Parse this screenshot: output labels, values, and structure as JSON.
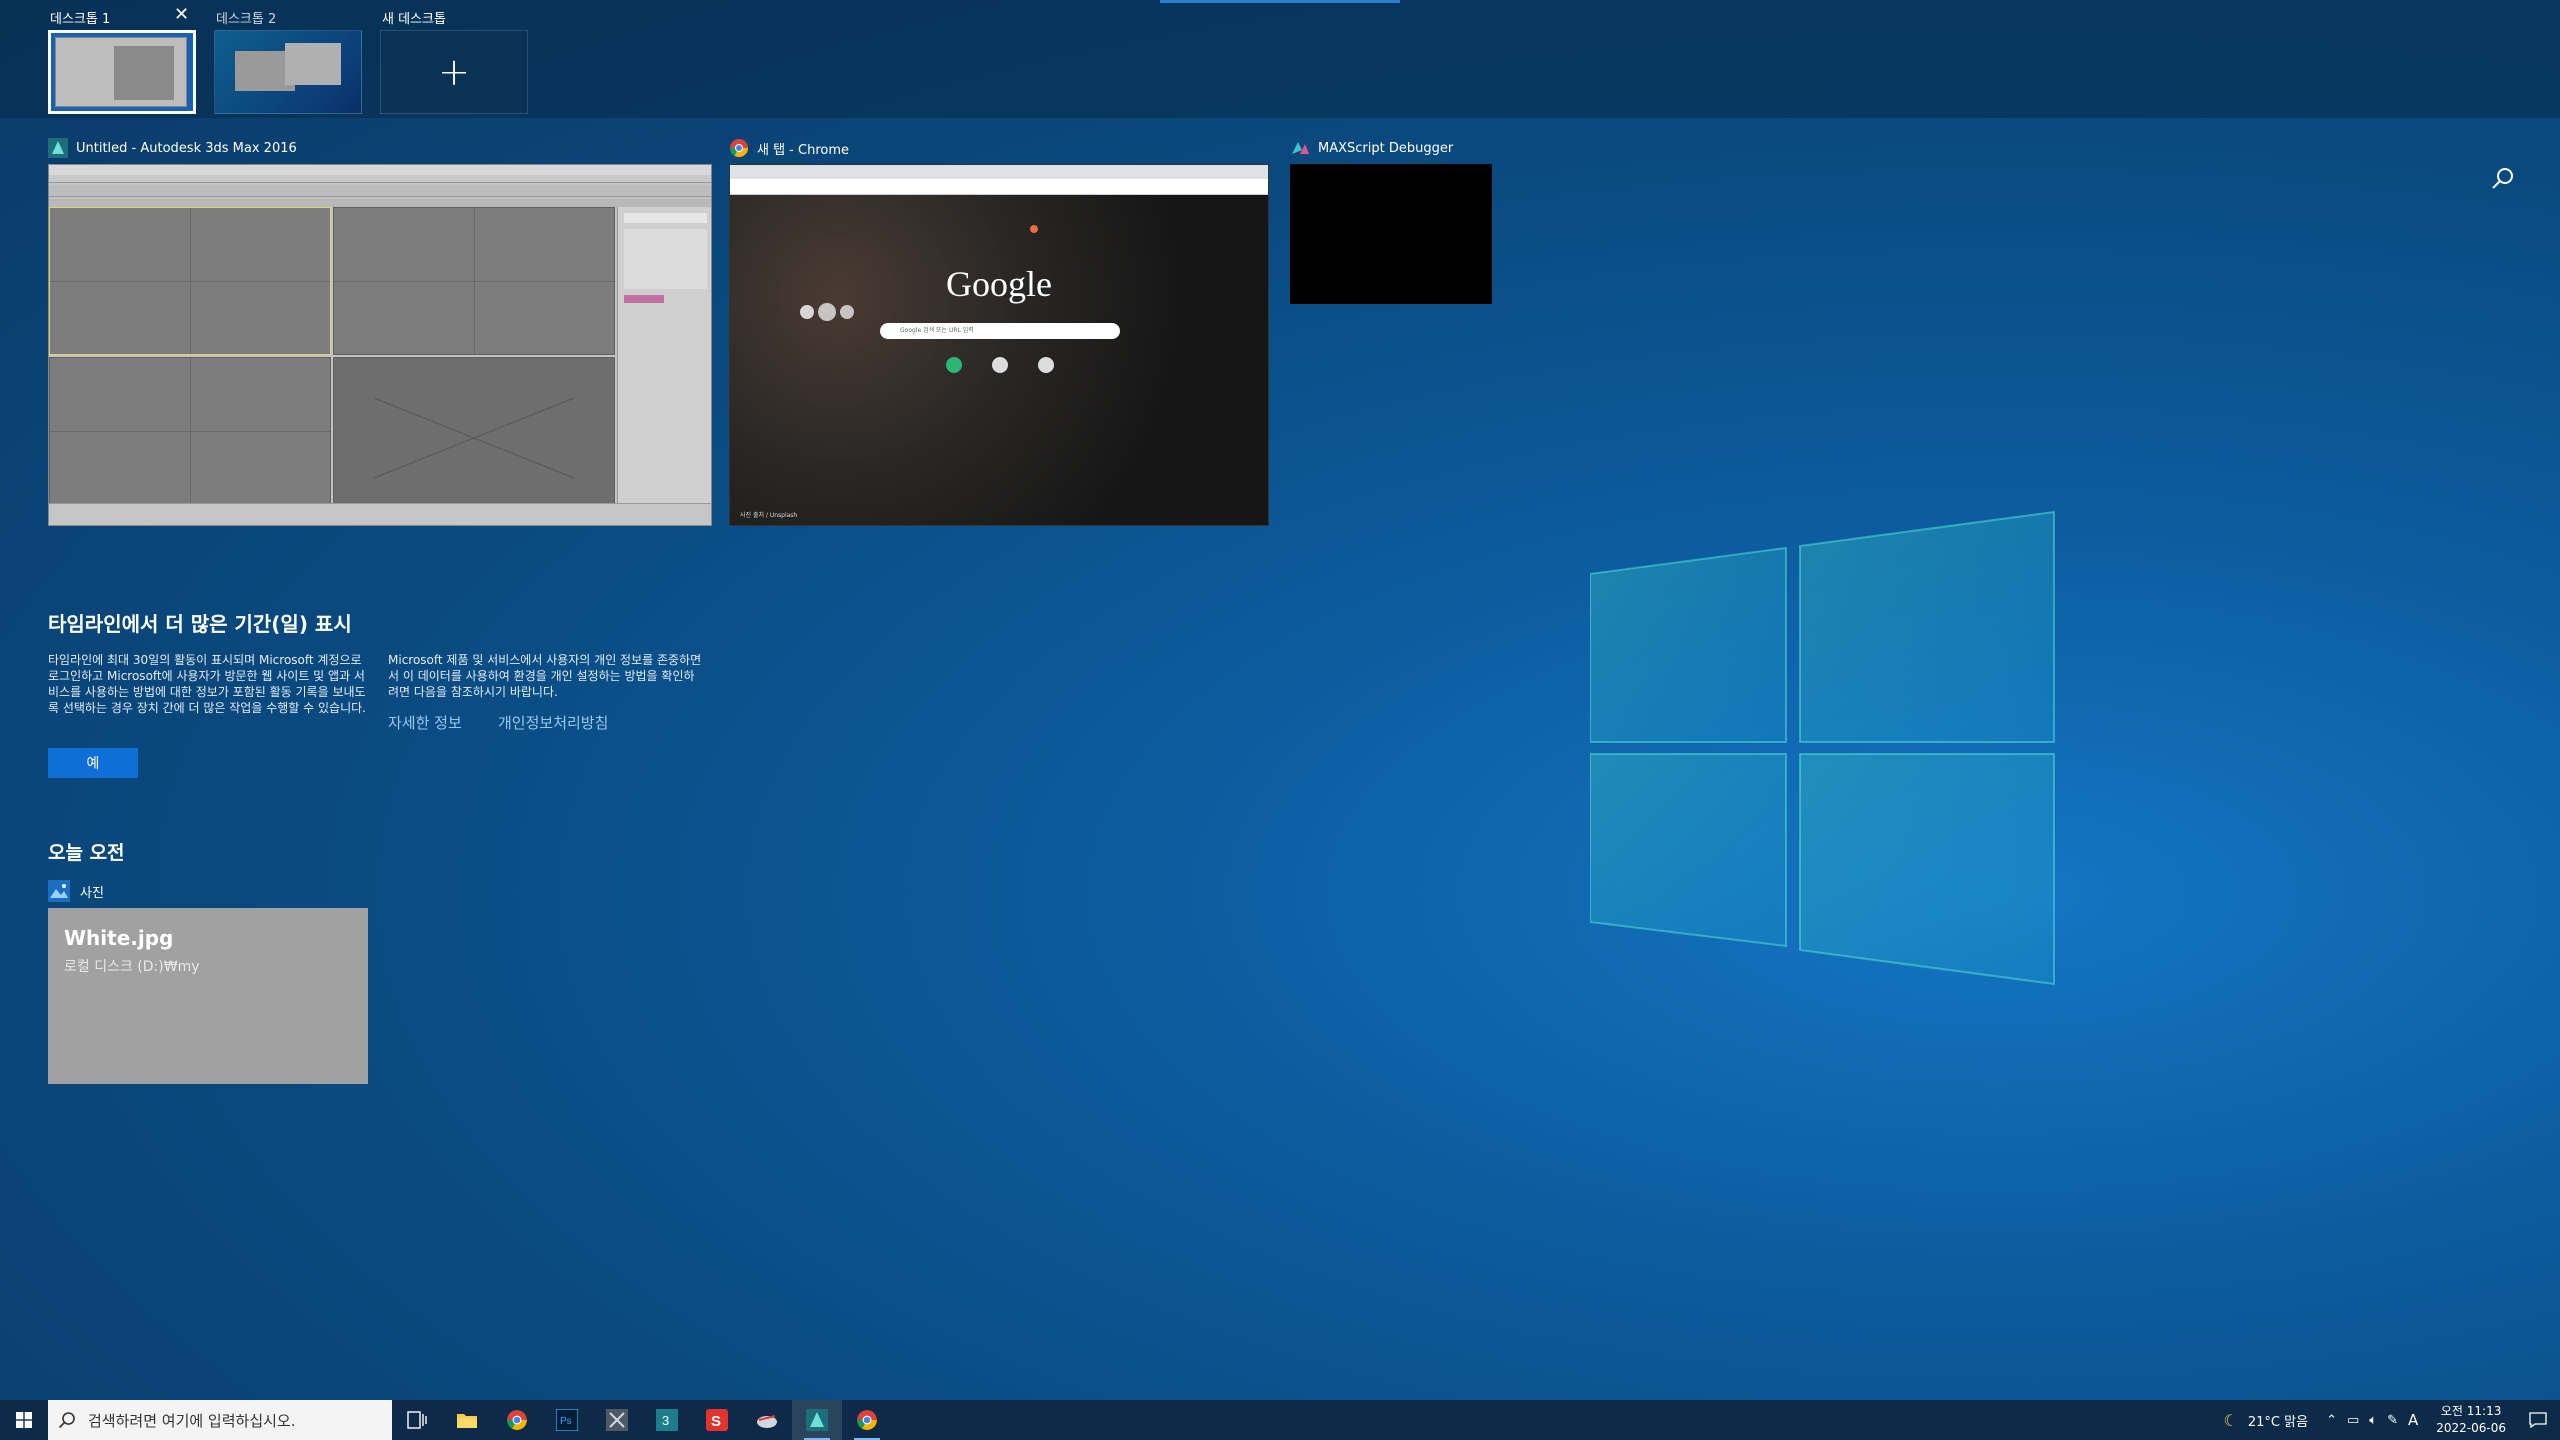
{
  "desktops": [
    {
      "label": "데스크톱 1",
      "active": true
    },
    {
      "label": "데스크톱 2",
      "active": false
    },
    {
      "label": "새 데스크톱",
      "active": false
    }
  ],
  "new_desktop_symbol": "+",
  "close_symbol": "✕",
  "windows": [
    {
      "title": "Untitled - Autodesk 3ds Max 2016",
      "icon": "3dsmax-icon"
    },
    {
      "title": "새 탭 - Chrome",
      "icon": "chrome-icon"
    },
    {
      "title": "MAXScript Debugger",
      "icon": "maxscript-icon"
    }
  ],
  "chrome_preview": {
    "logo": "Google",
    "search_placeholder": "Google 검색 또는 URL 입력",
    "bottom_credit": "사진 출처 / Unsplash"
  },
  "timeline": {
    "title": "타임라인에서 더 많은 기간(일) 표시",
    "left_text": "타임라인에 최대 30일의 활동이 표시되며 Microsoft 계정으로 로그인하고 Microsoft에 사용자가 방문한 웹 사이트 및 앱과 서비스를 사용하는 방법에 대한 정보가 포함된 활동 기록을 보내도록 선택하는 경우 장치 간에 더 많은 작업을 수행할 수 있습니다.",
    "right_text": "Microsoft 제품 및 서비스에서 사용자의 개인 정보를 존중하면서 이 데이터를 사용하여 환경을 개인 설정하는 방법을 확인하려면 다음을 참조하시기 바랍니다.",
    "link_more": "자세한 정보",
    "link_privacy": "개인정보처리방침",
    "yes_button": "예"
  },
  "today": {
    "heading": "오늘 오전",
    "app": "사진",
    "card_filename": "White.jpg",
    "card_path": "로컬 디스크 (D:)₩my"
  },
  "taskbar": {
    "search_placeholder": "검색하려면 여기에 입력하십시오.",
    "apps": [
      "task-view-icon",
      "file-explorer-icon",
      "chrome-icon",
      "photoshop-icon",
      "app-icon-5",
      "3dsmax-icon",
      "app-icon-s",
      "app-icon-cloud",
      "3dsmax-active-icon",
      "chrome-active-icon"
    ],
    "weather": "21°C 맑음",
    "ime": "A",
    "time": "오전 11:13",
    "date": "2022-06-06"
  },
  "colors": {
    "accent": "#0f6fd9",
    "taskbar": "#0d2b48",
    "link": "#9cc7ee"
  }
}
